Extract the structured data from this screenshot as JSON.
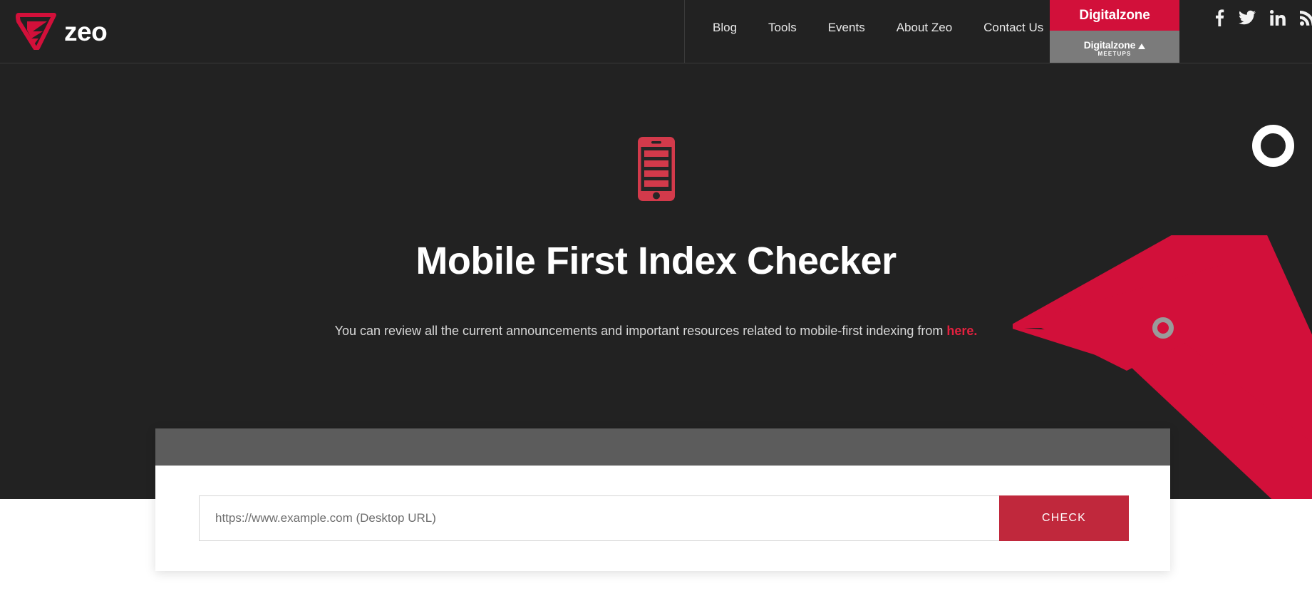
{
  "brand": {
    "logo_text": "zeo",
    "logo_icon": "zeo-logo-mark",
    "accent_red": "#d2103a",
    "dark_bg": "#222222",
    "button_red": "#c0283c"
  },
  "header": {
    "nav": [
      {
        "label": "Blog",
        "name": "nav-item-blog"
      },
      {
        "label": "Tools",
        "name": "nav-item-tools"
      },
      {
        "label": "Events",
        "name": "nav-item-events"
      },
      {
        "label": "About Zeo",
        "name": "nav-item-about-zeo"
      },
      {
        "label": "Contact Us",
        "name": "nav-item-contact-us"
      }
    ],
    "digitalzone": {
      "top_label": "Digitalzone",
      "bottom_label": "Digitalzone",
      "bottom_sub": "MEETUPS"
    },
    "social": [
      {
        "name": "facebook-icon",
        "label": "Facebook"
      },
      {
        "name": "twitter-icon",
        "label": "Twitter"
      },
      {
        "name": "linkedin-icon",
        "label": "LinkedIn"
      },
      {
        "name": "rss-icon",
        "label": "RSS"
      }
    ]
  },
  "hero": {
    "icon": "mobile-phone-icon",
    "title": "Mobile First Index Checker",
    "subtitle_before": "You can review all the current announcements and important resources related to mobile-first indexing from ",
    "subtitle_link": "here.",
    "decorations": {
      "white_ring": "ring-decoration",
      "gray_ring": "ring-decoration",
      "red_chevron": "chevron-decoration"
    }
  },
  "form": {
    "url_placeholder": "https://www.example.com (Desktop URL)",
    "url_value": "",
    "check_label": "CHECK"
  }
}
